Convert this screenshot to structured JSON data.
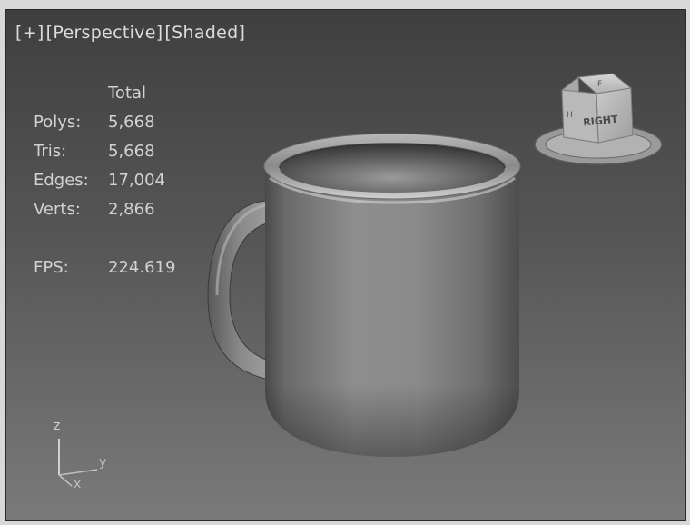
{
  "viewport": {
    "labels": {
      "menu": "[+]",
      "view": "[Perspective]",
      "shading": "[Shaded]"
    },
    "stats": {
      "header": "Total",
      "polys_label": "Polys:",
      "polys_value": "5,668",
      "tris_label": "Tris:",
      "tris_value": "5,668",
      "edges_label": "Edges:",
      "edges_value": "17,004",
      "verts_label": "Verts:",
      "verts_value": "2,866",
      "fps_label": "FPS:",
      "fps_value": "224.619"
    },
    "viewcube": {
      "face_label": "RIGHT",
      "top_label": "F",
      "side_label": "H"
    },
    "axis_tripod": {
      "z": "z",
      "y": "y",
      "x": "x"
    }
  }
}
